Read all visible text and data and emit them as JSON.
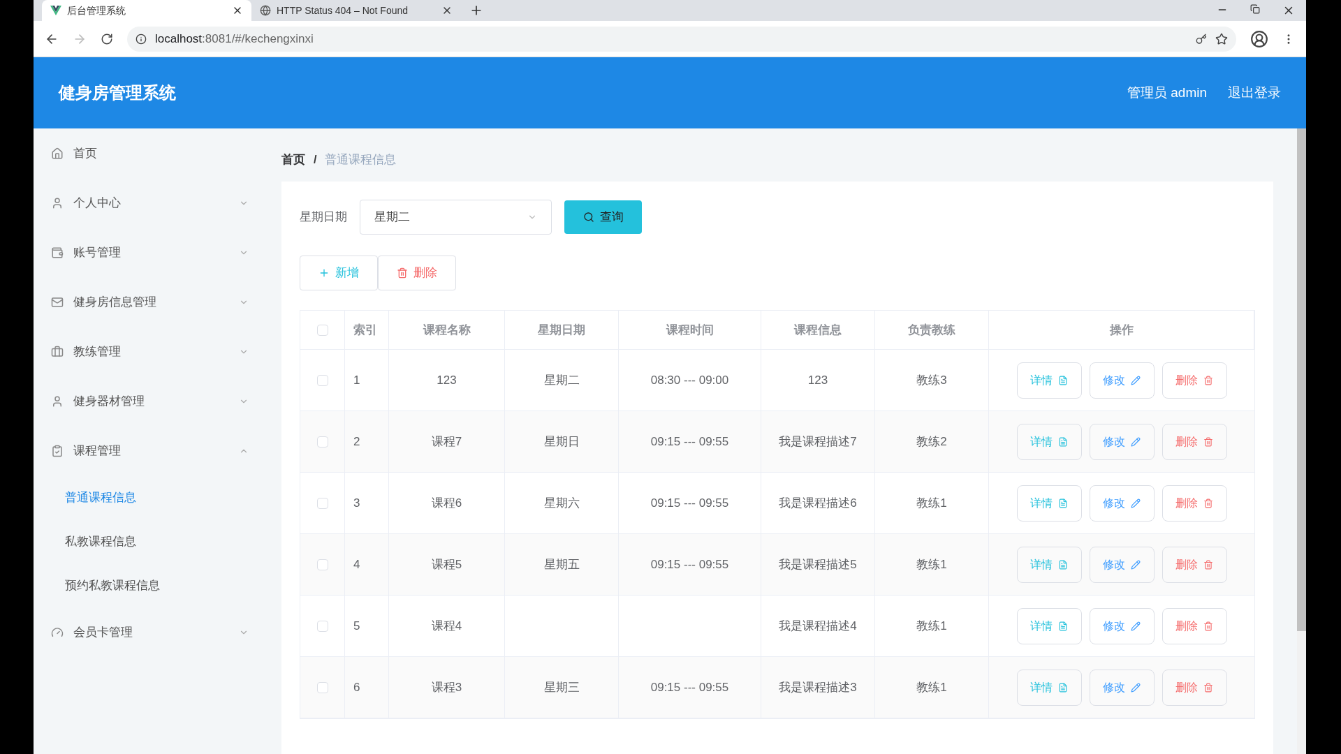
{
  "browser": {
    "tabs": [
      {
        "title": "后台管理系统",
        "selected": true
      },
      {
        "title": "HTTP Status 404 – Not Found",
        "selected": false
      }
    ],
    "url_host": "localhost",
    "url_rest": ":8081/#/kechengxinxi"
  },
  "header": {
    "title": "健身房管理系统",
    "user": "管理员 admin",
    "logout": "退出登录"
  },
  "sidebar": {
    "items": [
      {
        "label": "首页"
      },
      {
        "label": "个人中心",
        "expanded": false
      },
      {
        "label": "账号管理",
        "expanded": false
      },
      {
        "label": "健身房信息管理",
        "expanded": false
      },
      {
        "label": "教练管理",
        "expanded": false
      },
      {
        "label": "健身器材管理",
        "expanded": false
      },
      {
        "label": "课程管理",
        "expanded": true,
        "children": [
          {
            "label": "普通课程信息",
            "selected": true
          },
          {
            "label": "私教课程信息",
            "selected": false
          },
          {
            "label": "预约私教课程信息",
            "selected": false
          }
        ]
      },
      {
        "label": "会员卡管理",
        "expanded": false
      }
    ]
  },
  "breadcrumb": {
    "home": "首页",
    "separator": "/",
    "current": "普通课程信息"
  },
  "filter": {
    "label": "星期日期",
    "value": "星期二",
    "search_button": "查询"
  },
  "actions": {
    "add": "新增",
    "delete": "删除"
  },
  "table": {
    "header_checked": false,
    "columns": [
      "索引",
      "课程名称",
      "星期日期",
      "课程时间",
      "课程信息",
      "负责教练",
      "操作"
    ],
    "rows": [
      {
        "checked": false,
        "cells": [
          "1",
          "123",
          "星期二",
          "08:30 --- 09:00",
          "123",
          "教练3"
        ],
        "buttons": [
          "详情",
          "修改",
          "删除"
        ]
      },
      {
        "checked": false,
        "cells": [
          "2",
          "课程7",
          "星期日",
          "09:15 --- 09:55",
          "我是课程描述7",
          "教练2"
        ],
        "buttons": [
          "详情",
          "修改",
          "删除"
        ]
      },
      {
        "checked": false,
        "cells": [
          "3",
          "课程6",
          "星期六",
          "09:15 --- 09:55",
          "我是课程描述6",
          "教练1"
        ],
        "buttons": [
          "详情",
          "修改",
          "删除"
        ]
      },
      {
        "checked": false,
        "cells": [
          "4",
          "课程5",
          "星期五",
          "09:15 --- 09:55",
          "我是课程描述5",
          "教练1"
        ],
        "buttons": [
          "详情",
          "修改",
          "删除"
        ]
      },
      {
        "checked": false,
        "cells": [
          "5",
          "课程4",
          null,
          null,
          "我是课程描述4",
          "教练1"
        ],
        "buttons": [
          "详情",
          "修改",
          "删除"
        ]
      },
      {
        "checked": false,
        "cells": [
          "6",
          "课程3",
          "星期三",
          "09:15 --- 09:55",
          "我是课程描述3",
          "教练1"
        ],
        "buttons": [
          "详情",
          "修改",
          "删除"
        ]
      }
    ]
  }
}
